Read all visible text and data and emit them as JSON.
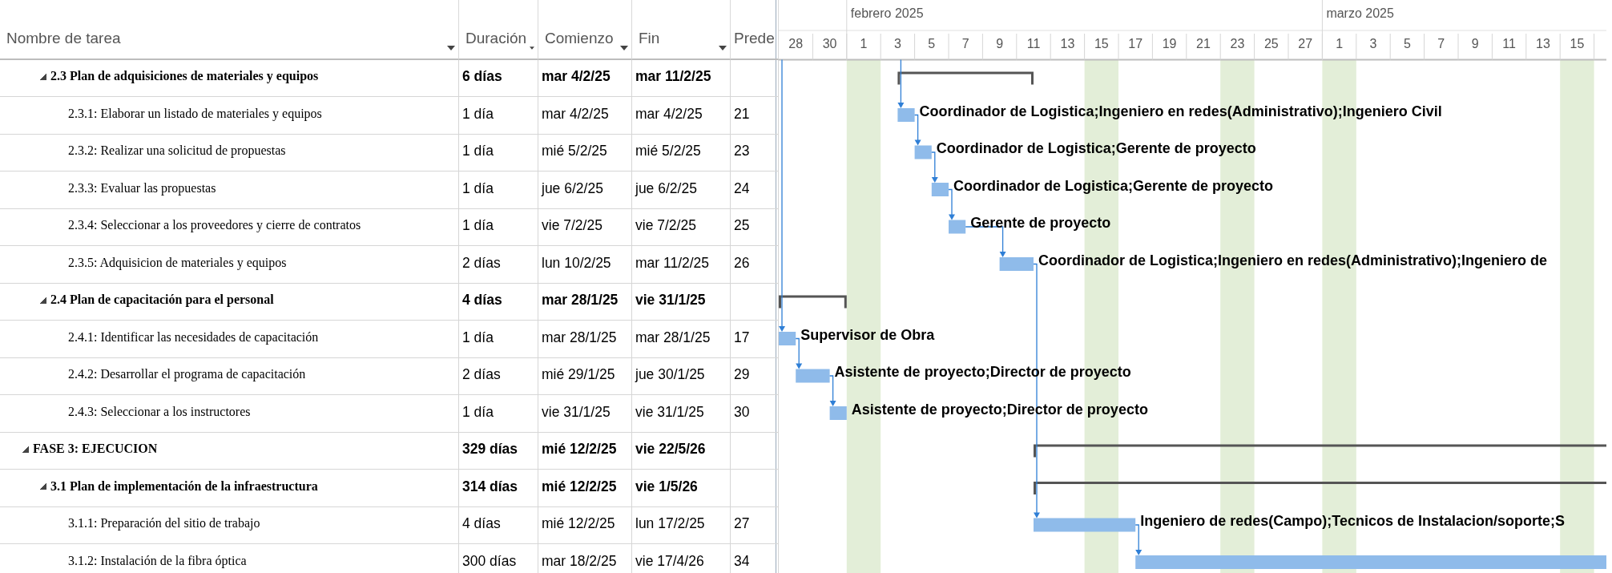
{
  "columns": [
    {
      "label": "Nombre de tarea",
      "dropdown": true
    },
    {
      "label": "Duración",
      "dropdown": true
    },
    {
      "label": "Comienzo",
      "dropdown": true
    },
    {
      "label": "Fin",
      "dropdown": true
    },
    {
      "label": "Prede",
      "dropdown": false
    }
  ],
  "timescale": {
    "months": [
      {
        "label": "febrero 2025"
      },
      {
        "label": "marzo 2025"
      }
    ],
    "days": [
      "28",
      "30",
      "1",
      "3",
      "5",
      "7",
      "9",
      "11",
      "13",
      "15",
      "17",
      "19",
      "21",
      "23",
      "25",
      "27",
      "1",
      "3",
      "5",
      "7",
      "9",
      "11",
      "13",
      "15"
    ]
  },
  "tasks": [
    {
      "kind": "summary",
      "name": "2.3 Plan de adquisiciones de materiales y equipos",
      "expanded": true,
      "duration": "6 días",
      "start": "mar 4/2/25",
      "finish": "mar 11/2/25",
      "children": [
        {
          "kind": "task",
          "name": "2.3.1: Elaborar un listado de materiales y equipos",
          "duration": "1 día",
          "start": "mar 4/2/25",
          "finish": "mar 4/2/25",
          "predecessors": "21",
          "resources": "Coordinador de Logistica;Ingeniero en redes(Administrativo);Ingeniero Civil"
        },
        {
          "kind": "task",
          "name": "2.3.2: Realizar una solicitud de propuestas",
          "duration": "1 día",
          "start": "mié 5/2/25",
          "finish": "mié 5/2/25",
          "predecessors": "23",
          "resources": "Coordinador de Logistica;Gerente de proyecto"
        },
        {
          "kind": "task",
          "name": "2.3.3: Evaluar las propuestas",
          "duration": "1 día",
          "start": "jue 6/2/25",
          "finish": "jue 6/2/25",
          "predecessors": "24",
          "resources": "Coordinador de Logistica;Gerente de proyecto"
        },
        {
          "kind": "task",
          "name": "2.3.4: Seleccionar a los proveedores y cierre de contratos",
          "duration": "1 día",
          "start": "vie 7/2/25",
          "finish": "vie 7/2/25",
          "predecessors": "25",
          "resources": "Gerente de proyecto"
        },
        {
          "kind": "task",
          "name": "2.3.5: Adquisicion de materiales y equipos",
          "duration": "2 días",
          "start": "lun 10/2/25",
          "finish": "mar 11/2/25",
          "predecessors": "26",
          "resources": "Coordinador de Logistica;Ingeniero en redes(Administrativo);Ingeniero de"
        }
      ]
    },
    {
      "kind": "summary",
      "name": "2.4 Plan de capacitación para el personal",
      "expanded": true,
      "duration": "4 días",
      "start": "mar 28/1/25",
      "finish": "vie 31/1/25",
      "children": [
        {
          "kind": "task",
          "name": "2.4.1: Identificar las necesidades de capacitación",
          "duration": "1 día",
          "start": "mar 28/1/25",
          "finish": "mar 28/1/25",
          "predecessors": "17",
          "resources": "Supervisor de Obra"
        },
        {
          "kind": "task",
          "name": "2.4.2: Desarrollar el programa de capacitación",
          "duration": "2 días",
          "start": "mié 29/1/25",
          "finish": "jue 30/1/25",
          "predecessors": "29",
          "resources": "Asistente de proyecto;Director de proyecto"
        },
        {
          "kind": "task",
          "name": "2.4.3: Seleccionar a los instructores",
          "duration": "1 día",
          "start": "vie 31/1/25",
          "finish": "vie 31/1/25",
          "predecessors": "30",
          "resources": "Asistente de proyecto;Director de proyecto"
        }
      ]
    },
    {
      "kind": "phase",
      "name": "FASE 3: EJECUCION",
      "expanded": true,
      "duration": "329 días",
      "start": "mié 12/2/25",
      "finish": "vie 22/5/26",
      "children": [
        {
          "kind": "summary",
          "name": "3.1 Plan de implementación de la infraestructura",
          "expanded": true,
          "duration": "314 días",
          "start": "mié 12/2/25",
          "finish": "vie 1/5/26",
          "children": [
            {
              "kind": "task",
              "name": "3.1.1: Preparación del sitio de trabajo",
              "duration": "4 días",
              "start": "mié 12/2/25",
              "finish": "lun 17/2/25",
              "predecessors": "27",
              "resources": "Ingeniero de redes(Campo);Tecnicos de Instalacion/soporte;S"
            },
            {
              "kind": "task",
              "name": "3.1.2: Instalación de la fibra óptica",
              "duration": "300 días",
              "start": "mar 18/2/25",
              "finish": "vie 17/4/26",
              "predecessors": "34"
            }
          ]
        }
      ]
    }
  ]
}
